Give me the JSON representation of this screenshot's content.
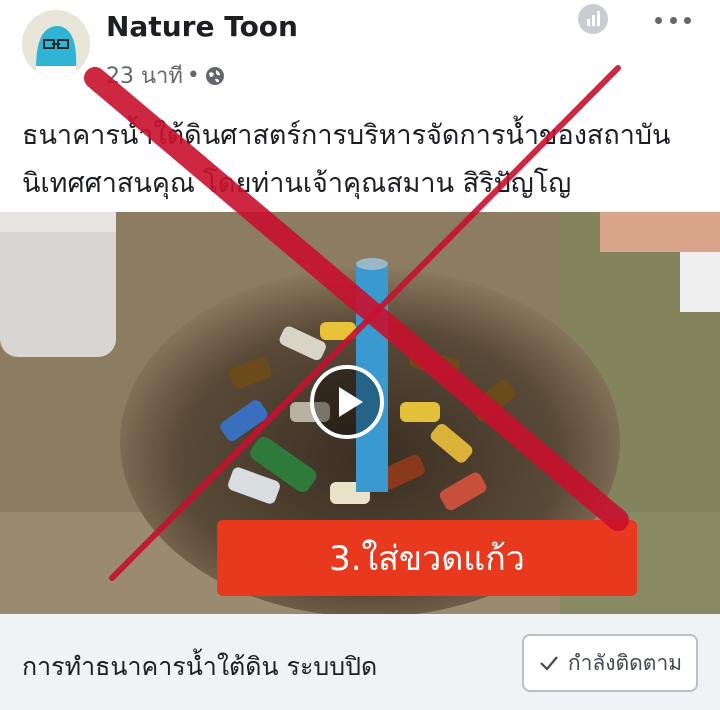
{
  "post": {
    "author": "Nature Toon",
    "time_label": "23 นาที",
    "separator": "•",
    "text_line1": "ธนาคารน้ำใต้ดินศาสตร์การบริหารจัดการน้ำของสถาบัน",
    "text_line2": "นิเทศศาสนคุณ โดยท่านเจ้าคุณสมาน สิริปัญโญ"
  },
  "media": {
    "caption": "3.ใส่ขวดแก้ว"
  },
  "footer": {
    "title": "การทำธนาคารน้ำใต้ดิน ระบบปิด",
    "follow_label": "กำลังติดตาม"
  },
  "colors": {
    "overlay_x": "#c8102e",
    "banner": "#e8391e",
    "footer_bg": "#f0f2f5"
  },
  "icons": {
    "stats": "stats-icon",
    "more": "more-icon",
    "globe": "globe-icon",
    "play": "play-icon",
    "check": "check-icon"
  }
}
